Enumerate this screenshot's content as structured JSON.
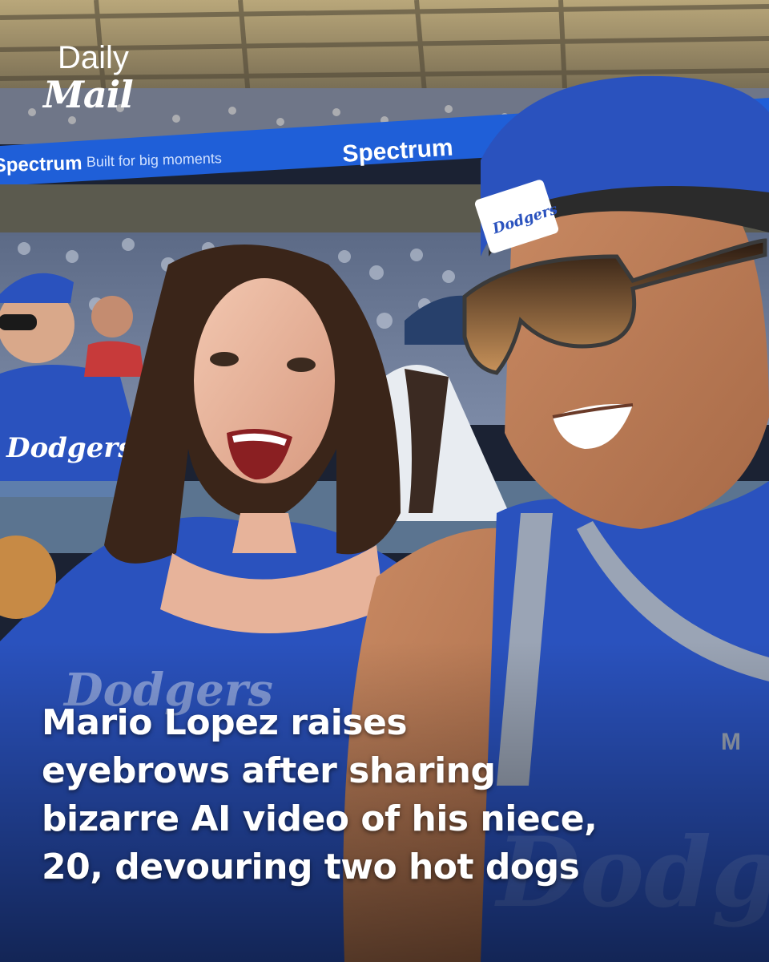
{
  "brand": {
    "line1": "Daily",
    "line2": "Mail"
  },
  "banner": {
    "sponsor": "Spectrum",
    "tagline": "Built for big moments",
    "color": "#1f5fd8"
  },
  "caps": {
    "woman_cap_text": "Dodgers",
    "man_cap_text": "Dodgers"
  },
  "headline": {
    "lines": [
      "Mario Lopez raises",
      "eyebrows after sharing",
      "bizarre AI video of his niece,",
      "20, devouring two hot dogs"
    ]
  },
  "colors": {
    "dodger_blue": "#2a52be",
    "headline_text": "#ffffff"
  }
}
